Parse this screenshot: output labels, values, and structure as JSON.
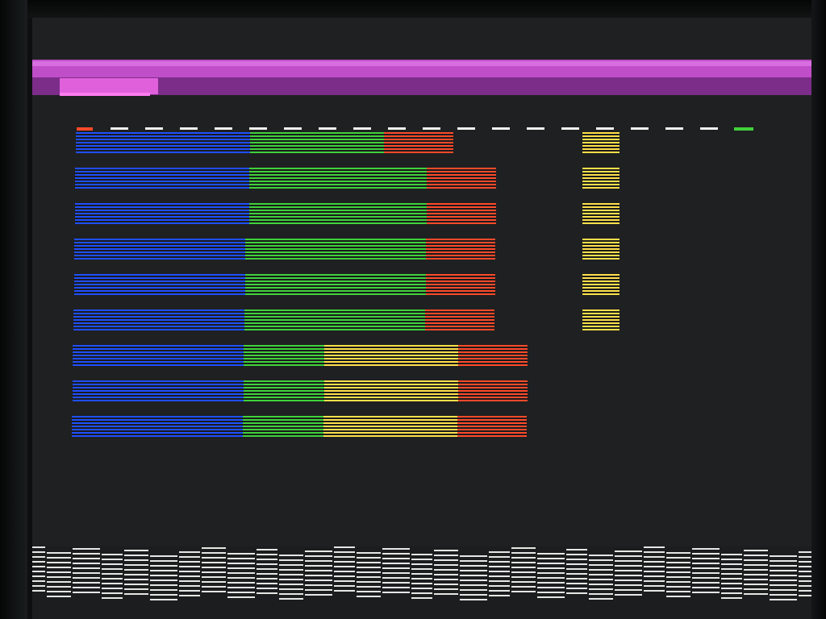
{
  "display": {
    "colors": {
      "screen_bg": "#1f2021",
      "band_primary": "#c04ec8",
      "band_secondary": "#7c2d8a",
      "band_tab": "#e060dc",
      "blue": "#1f4fff",
      "green": "#3fd23b",
      "red": "#ff4a2a",
      "yellow": "#ffe04a",
      "white": "#f2f2f0"
    }
  },
  "ruler": {
    "left_marker_color": "#ff4a2a",
    "right_marker_color": "#3fd23b"
  },
  "bars": [
    {
      "segments": [
        {
          "color": "blue",
          "units": 216
        },
        {
          "color": "green",
          "units": 166
        },
        {
          "color": "red",
          "units": 86
        }
      ]
    },
    {
      "segments": [
        {
          "color": "blue",
          "units": 216
        },
        {
          "color": "green",
          "units": 220
        },
        {
          "color": "red",
          "units": 86
        }
      ]
    },
    {
      "segments": [
        {
          "color": "blue",
          "units": 216
        },
        {
          "color": "green",
          "units": 220
        },
        {
          "color": "red",
          "units": 86
        }
      ]
    },
    {
      "segments": [
        {
          "color": "blue",
          "units": 212
        },
        {
          "color": "green",
          "units": 224
        },
        {
          "color": "red",
          "units": 86
        }
      ]
    },
    {
      "segments": [
        {
          "color": "blue",
          "units": 212
        },
        {
          "color": "green",
          "units": 224
        },
        {
          "color": "red",
          "units": 86
        }
      ]
    },
    {
      "segments": [
        {
          "color": "blue",
          "units": 212
        },
        {
          "color": "green",
          "units": 224
        },
        {
          "color": "red",
          "units": 86
        }
      ]
    },
    {
      "segments": [
        {
          "color": "blue",
          "units": 212
        },
        {
          "color": "green",
          "units": 100
        },
        {
          "color": "yellow",
          "units": 166
        },
        {
          "color": "red",
          "units": 86
        }
      ]
    },
    {
      "segments": [
        {
          "color": "blue",
          "units": 212
        },
        {
          "color": "green",
          "units": 100
        },
        {
          "color": "yellow",
          "units": 166
        },
        {
          "color": "red",
          "units": 86
        }
      ]
    },
    {
      "segments": [
        {
          "color": "blue",
          "units": 212
        },
        {
          "color": "green",
          "units": 100
        },
        {
          "color": "yellow",
          "units": 166
        },
        {
          "color": "red",
          "units": 86
        }
      ]
    }
  ],
  "side_blocks": {
    "count": 6,
    "color": "yellow"
  }
}
